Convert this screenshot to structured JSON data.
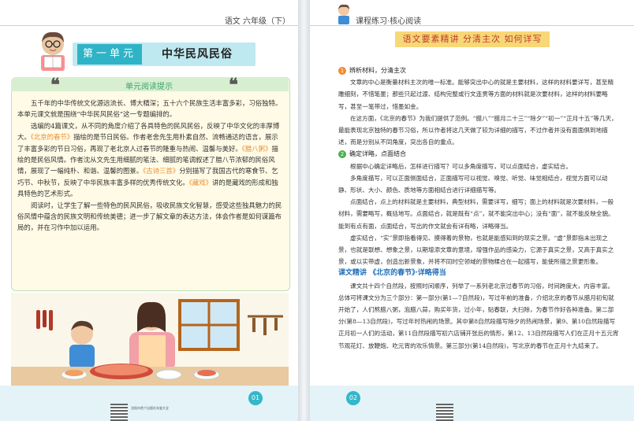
{
  "left": {
    "header": "语文 六年级（下）",
    "unit_label": "第一单元",
    "unit_title": "中华民风民俗",
    "tips_title": "单元阅读提示",
    "paragraphs": [
      [
        "五千年的中华传统文化源远流长、博大精深；五十六个民族生活丰富多彩，习俗独特。本单元课文就是围绕“中华民风民俗”这一专题编排的。"
      ],
      [
        "选编的4篇课文，从不同的角度介绍了各具特色的民风民俗，反映了中华文化的丰厚博大。",
        "《北京的春节》",
        "描绘的是节日民俗。作者老舍先生用朴素自然、流畅通达的语言，展示了丰富多彩的节日习俗，再现了老北京人过春节的隆重与热闹、温馨与美好。",
        "《腊八粥》",
        "描绘的是民俗风情。作者沈从文先生用细腻的笔法、细腻的笔调叙述了腊八节浓郁的民俗风情，展现了一幅纯朴、和谐、温馨的图景。",
        "《古诗三首》",
        "分别描写了我国古代的寒食节、乞巧节、中秋节，反映了中华民族丰富多样的优秀传统文化。",
        "《藏戏》",
        "讲的是藏戏的形成和独具特色的艺术形式。"
      ],
      [
        "阅读时，让学生了解一些特色的民风民俗，吸收民族文化智慧，感受这些独具魅力的民俗风情中蕴含的民族文明和传统美德；进一步了解文章的表达方法，体会作者是如何谋篇布局的，并在习作中加以运用。"
      ]
    ],
    "page_number": "01",
    "footer": "沈阳市首个出版社年鉴大全"
  },
  "right": {
    "header": "课程练习·核心阅读",
    "banner": "语文要素精讲  分清主次  如何详写",
    "section1_title": "辨析材料，分清主次",
    "section1_num": "1",
    "s1_p1": "文章的中心是衡量材料主次的唯一标准。能够突出中心的就是主要材料，这样的材料要详写，甚至精雕细刻，不惜笔墨；那些只起过渡、结构完整或行文连贯等方面的材料就是次要材料，这样的材料要略写，甚至一笔带过，惜墨如金。",
    "s1_p2": "在这方面，《北京的春节》为我们提供了范例。“腊八”“腊月二十三”“除夕”“初一”“正月十五”等几天，最能表现北京独特的春节习俗，所以作者将这几天做了较为详细的描写，不过作者并没有面面俱到地描述，而是分别从不同角度，突出各自的重点。",
    "section2_title": "确定详略，点面结合",
    "section2_num": "2",
    "s2_p1": "根据中心确定详略后，怎样进行描写？可以多角度描写，可以点面结合，虚实结合。",
    "s2_p2": "多角度描写，可以正面侧面结合，正面描写可以视觉、嗅觉、听觉、味觉相结合，视觉方面可以动静、形状、大小、颜色、质地等方面相结合进行详细描写等。",
    "s2_p3": "点面结合，点上的材料就是主要材料，典型材料，需要详写，细写；面上的材料就是次要材料，一般材料，需要略写，概括地写。点面结合，就是既有“点”，就不能突出中心；没有“面”，就不能反映全貌。能到有点有面，点面结合，写出的作文就会有详有略，详略得当。",
    "s2_p4": "虚实结合，“实”景即指看得见、摸得着的景物，也就是能感知到的现实之景。“虚”景即指未出现之景，也就是联想、想象之景，以期增添文章的意境，增强作品的感染力，它源于真实之景，又高于真实之景，或以实带虚，创造出新景象，并将不同时空领域的景物糅合在一起描写，能使所描之景更形象。",
    "sub_title": "课文精讲 《北京的春节》·详略得当",
    "s3_p1": "课文共十四个自然段，按照时间顺序，列举了一系列老北京过春节的习俗，时间跨度大，内容丰富。总体可将课文分为三个部分：第一部分(第1—7自然段)，写过年前的准备，介绍北京的春节从腊月初旬就开始了，人们熬腊八粥，泡腊八蒜，购买年货，过小年，贴春联，大扫除，为春节作好各种准备。第二部分(第8—13自然段)，写过年时热闹的场景。其中第8自然段描写除夕的热闹场景，第9、第10自然段描写正月初一人们的活动，第11自然段描写初六店铺开张后的情形，第12、13自然段描写人们在正月十五元宵节观花灯、放鞭炮、吃元宵的欢乐情景。第三部分(第14自然段)，写北京的春节在正月十九结束了。",
    "page_number": "02"
  },
  "colors": {
    "accent": "#2fb3c6",
    "highlight": "#f08b2a",
    "banner_bg": "#f7d777",
    "banner_text": "#c0392b",
    "bullet1": "#f08b2a",
    "bullet2": "#4caf50",
    "subtitle": "#2070b8"
  }
}
